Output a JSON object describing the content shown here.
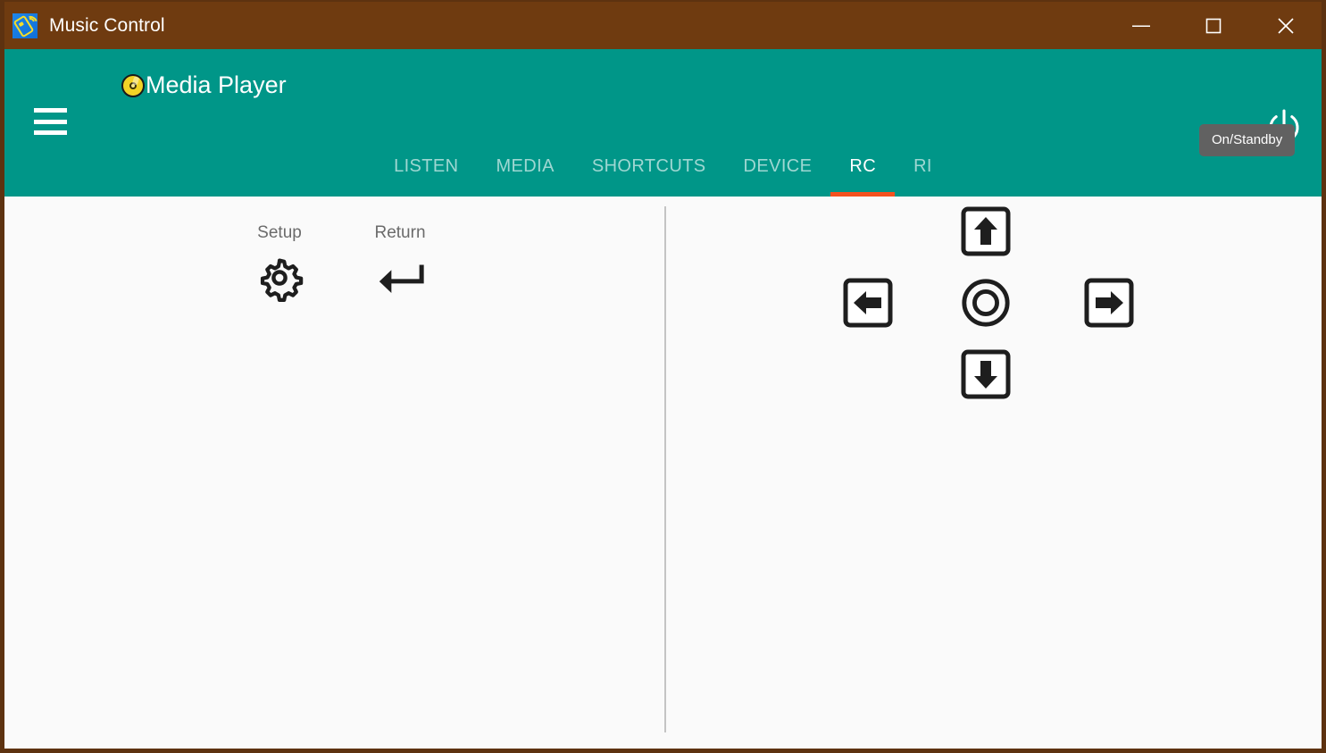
{
  "window": {
    "title": "Music Control",
    "app_icon": "remote-control-icon",
    "frame_color": "#6f3b10",
    "controls": [
      {
        "name": "minimize",
        "glyph": "minimize-icon"
      },
      {
        "name": "maximize",
        "glyph": "maximize-icon"
      },
      {
        "name": "close",
        "glyph": "close-icon"
      }
    ]
  },
  "appbar": {
    "background": "#009688",
    "menu_icon": "hamburger-menu-icon",
    "device_icon": "compact-disc-icon",
    "device_name": "Media Player",
    "power_icon": "power-icon",
    "power_tooltip": "On/Standby"
  },
  "tabs": {
    "active_index": 4,
    "active_indicator_color": "#f4511e",
    "items": [
      {
        "label": "LISTEN",
        "active": false
      },
      {
        "label": "MEDIA",
        "active": false
      },
      {
        "label": "SHORTCUTS",
        "active": false
      },
      {
        "label": "DEVICE",
        "active": false
      },
      {
        "label": "RC",
        "active": true
      },
      {
        "label": "RI",
        "active": false
      }
    ]
  },
  "content": {
    "background": "#fafafa",
    "left_pane": {
      "keys": [
        {
          "label": "Setup",
          "icon": "gear-icon"
        },
        {
          "label": "Return",
          "icon": "return-arrow-icon"
        }
      ]
    },
    "right_pane": {
      "dpad": [
        {
          "name": "up",
          "icon": "arrow-up-icon"
        },
        {
          "name": "left",
          "icon": "arrow-left-icon"
        },
        {
          "name": "enter",
          "icon": "enter-circle-icon"
        },
        {
          "name": "right",
          "icon": "arrow-right-icon"
        },
        {
          "name": "down",
          "icon": "arrow-down-icon"
        }
      ]
    }
  }
}
